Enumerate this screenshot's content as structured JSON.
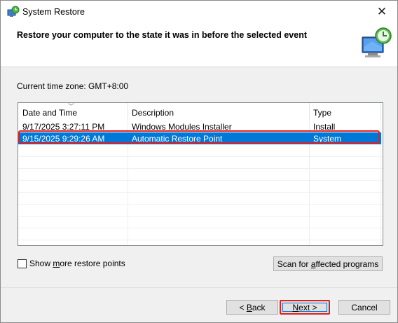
{
  "window": {
    "title": "System Restore",
    "headline": "Restore your computer to the state it was in before the selected event"
  },
  "timezone": {
    "label": "Current time zone: GMT+8:00"
  },
  "table": {
    "columns": [
      "Date and Time",
      "Description",
      "Type"
    ],
    "rows": [
      {
        "date": "9/17/2025 3:27:11 PM",
        "description": "Windows Modules Installer",
        "type": "Install",
        "selected": false
      },
      {
        "date": "9/15/2025 9:29:26 AM",
        "description": "Automatic Restore Point",
        "type": "System",
        "selected": true
      }
    ]
  },
  "options": {
    "show_more_pre": "Show ",
    "show_more_key": "m",
    "show_more_post": "ore restore points",
    "scan_pre": "Scan for ",
    "scan_key": "a",
    "scan_post": "ffected programs"
  },
  "buttons": {
    "back_pre": "< ",
    "back_key": "B",
    "back_post": "ack",
    "next_key": "N",
    "next_post": "ext >",
    "cancel": "Cancel"
  },
  "colors": {
    "selection": "#0078d7",
    "highlight_annotation": "#e02020"
  },
  "icons": {
    "app": "system-restore-icon",
    "header": "monitor-restore-clock-icon",
    "close": "close-icon"
  }
}
